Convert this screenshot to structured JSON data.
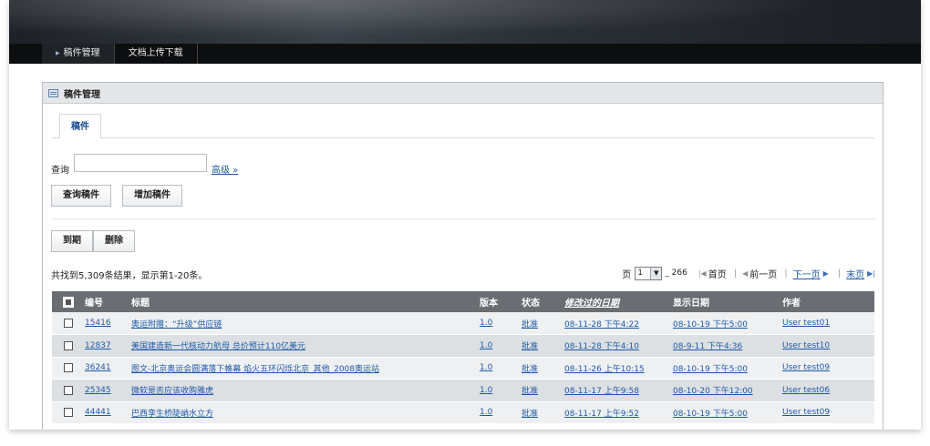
{
  "nav": {
    "items": [
      {
        "label": "稿件管理"
      },
      {
        "label": "文档上传下载"
      }
    ]
  },
  "panel": {
    "title": "稿件管理",
    "tab_label": "稿件"
  },
  "search": {
    "label": "查询",
    "value": "",
    "advanced_label": "高级 »"
  },
  "buttons": {
    "query": "查询稿件",
    "add": "增加稿件",
    "expire": "到期",
    "delete": "删除"
  },
  "results": {
    "summary": "共找到5,309条结果，显示第1-20条。"
  },
  "pager": {
    "page_label": "页",
    "current_page": "1",
    "total_pages": "_ 266",
    "first": "首页",
    "prev": "前一页",
    "next": "下一页",
    "last": "末页"
  },
  "table": {
    "columns": {
      "id": "编号",
      "title": "标题",
      "version": "版本",
      "status": "状态",
      "modified": "修改过的日期",
      "display_date": "显示日期",
      "author": "作者"
    },
    "rows": [
      {
        "id": "15416",
        "title": "奥运附赠：“升级”供应链",
        "version": "1.0",
        "status": "批准",
        "modified": "08-11-28 下午4:22",
        "display_date": "08-10-19 下午5:00",
        "author": "User test01"
      },
      {
        "id": "12837",
        "title": "美国建造新一代核动力航母 总价预计110亿美元",
        "version": "1.0",
        "status": "批准",
        "modified": "08-11-28 下午4:10",
        "display_date": "08-9-11 下午4:36",
        "author": "User test10"
      },
      {
        "id": "36241",
        "title": "图文-北京奥运会圆满落下帷幕 焰火五环闪烁北京_其他_2008奥运站",
        "version": "1.0",
        "status": "批准",
        "modified": "08-11-26 上午10:15",
        "display_date": "08-10-19 下午5:00",
        "author": "User test09"
      },
      {
        "id": "25345",
        "title": "微软是否应该收购雅虎",
        "version": "1.0",
        "status": "批准",
        "modified": "08-11-17 上午9:58",
        "display_date": "08-10-20 下午12:00",
        "author": "User test06"
      },
      {
        "id": "44441",
        "title": "巴西孪生桥陡峭水立方",
        "version": "1.0",
        "status": "批准",
        "modified": "08-11-17 上午9:52",
        "display_date": "08-10-19 下午5:00",
        "author": "User test09"
      }
    ]
  },
  "colors": {
    "banner_dark": "#1d2127",
    "navbar": "#0d0e10",
    "table_header": "#6a6e73",
    "link": "#1f5aa8",
    "row_odd": "#eef0f2",
    "row_even": "#dde0e3"
  }
}
